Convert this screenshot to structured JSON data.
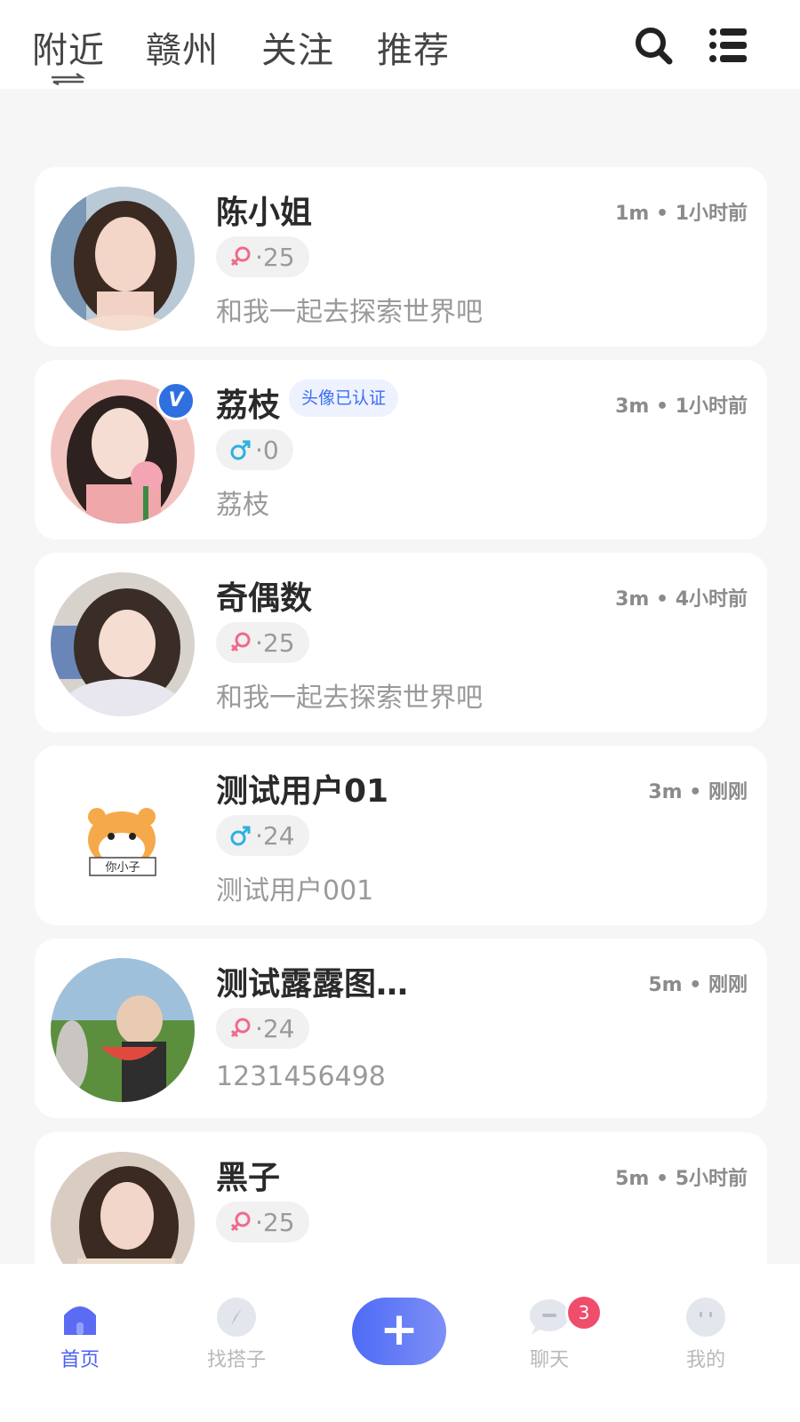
{
  "header": {
    "tabs": [
      {
        "label": "附近",
        "active": true
      },
      {
        "label": "赣州"
      },
      {
        "label": "关注"
      },
      {
        "label": "推荐"
      }
    ],
    "icons": [
      "search-icon",
      "menu-list-icon"
    ]
  },
  "users": [
    {
      "name": "陈小姐",
      "gender": "female",
      "age": "·25",
      "distance_time": "1m • 1小时前",
      "bio": "和我一起去探索世界吧",
      "verified": false
    },
    {
      "name": "荔枝",
      "gender": "male",
      "age": "·0",
      "distance_time": "3m • 1小时前",
      "bio": "荔枝",
      "verified": true,
      "verify_badge": "V",
      "verify_tag": "头像已认证"
    },
    {
      "name": "奇偶数",
      "gender": "female",
      "age": "·25",
      "distance_time": "3m • 4小时前",
      "bio": "和我一起去探索世界吧",
      "verified": false
    },
    {
      "name": "测试用户01",
      "gender": "male",
      "age": "·24",
      "distance_time": "3m • 刚刚",
      "bio": "测试用户001",
      "verified": false,
      "avatar_mascot_text": "你小子"
    },
    {
      "name": "测试露露图…",
      "gender": "female",
      "age": "·24",
      "distance_time": "5m • 刚刚",
      "bio": "1231456498",
      "verified": false
    },
    {
      "name": "黑子",
      "gender": "female",
      "age": "·25",
      "distance_time": "5m • 5小时前",
      "bio": "",
      "verified": false
    }
  ],
  "colors": {
    "accent": "#4c63f2",
    "female": "#ef6a8a",
    "male": "#2fb0e0",
    "badge": "#ef4d6a"
  },
  "tabbar": {
    "items": [
      {
        "label": "首页",
        "icon": "home-icon",
        "active": true
      },
      {
        "label": "找搭子",
        "icon": "compass-icon"
      },
      {
        "label": "聊天",
        "icon": "chat-icon",
        "badge": "3"
      },
      {
        "label": "我的",
        "icon": "profile-icon"
      }
    ],
    "plus_label": "+"
  }
}
